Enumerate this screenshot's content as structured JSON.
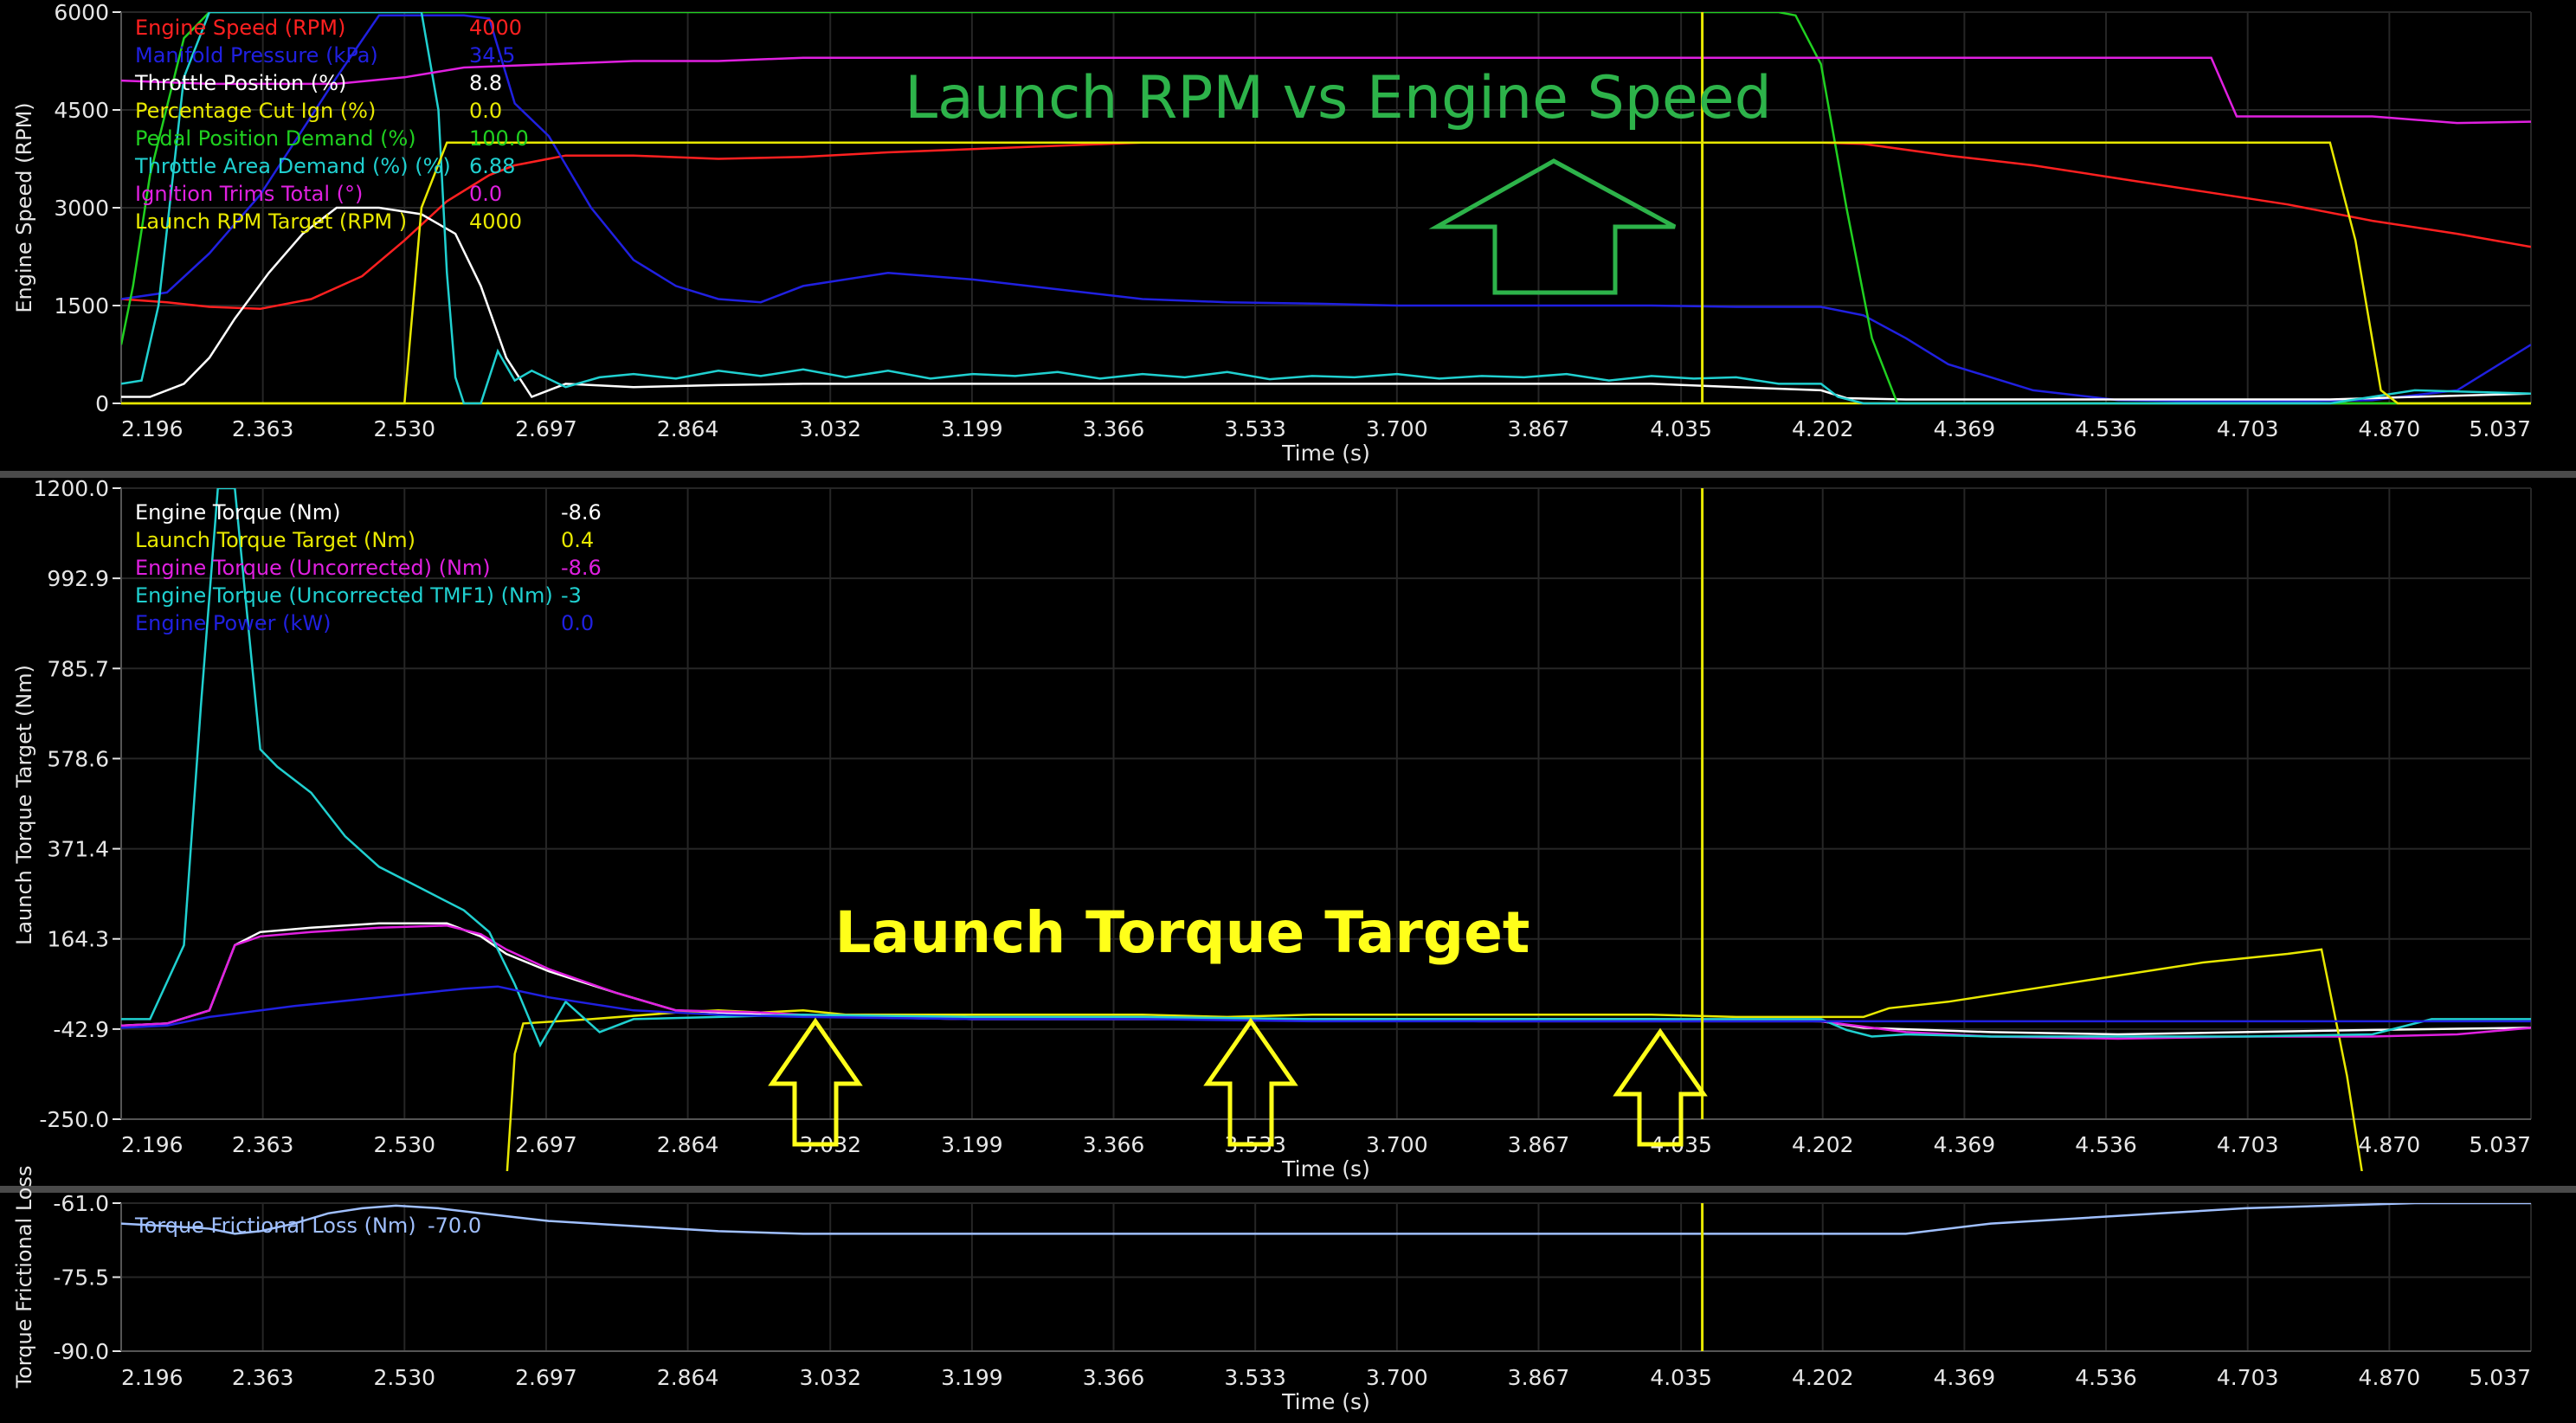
{
  "colors": {
    "background": "#000000",
    "grid": "#262626",
    "axis_text": "#e6e6e6",
    "divider": "#4a4a4a",
    "cursor": "#e8e800",
    "annotation_green": "#2db34a",
    "annotation_yellow": "#ffff1a"
  },
  "time_ticks": [
    "2.196",
    "2.363",
    "2.530",
    "2.697",
    "2.864",
    "3.032",
    "3.199",
    "3.366",
    "3.533",
    "3.700",
    "3.867",
    "4.035",
    "4.202",
    "4.369",
    "4.536",
    "4.703",
    "4.870",
    "5.037"
  ],
  "xlabel": "Time (s)",
  "cursor_time": 4.06,
  "chart_data": [
    {
      "type": "line",
      "ylabel": "Engine Speed (RPM)",
      "ylim": [
        0,
        6000
      ],
      "xlim": [
        2.196,
        5.037
      ],
      "y_ticks": [
        "6000",
        "4500",
        "3000",
        "1500",
        "0"
      ],
      "grid": true,
      "legend_placement": "top-left",
      "annotation": "Launch RPM vs Engine Speed",
      "series": [
        {
          "name": "Engine Speed (RPM)",
          "cursor_value": "4000",
          "color": "#ff2020",
          "x": [
            2.196,
            2.25,
            2.3,
            2.36,
            2.42,
            2.48,
            2.53,
            2.58,
            2.63,
            2.66,
            2.72,
            2.8,
            2.9,
            3.0,
            3.1,
            3.2,
            3.3,
            3.4,
            3.5,
            3.6,
            3.7,
            3.8,
            3.9,
            4.0,
            4.1,
            4.2,
            4.25,
            4.35,
            4.45,
            4.55,
            4.65,
            4.75,
            4.85,
            4.95,
            5.037
          ],
          "y": [
            1600,
            1550,
            1480,
            1450,
            1600,
            1950,
            2500,
            3100,
            3500,
            3650,
            3800,
            3800,
            3750,
            3780,
            3850,
            3900,
            3950,
            4000,
            4000,
            4000,
            4000,
            4000,
            4000,
            4000,
            4000,
            4000,
            3980,
            3800,
            3650,
            3450,
            3250,
            3050,
            2800,
            2600,
            2400
          ]
        },
        {
          "name": "Manifold Pressure (kPa)",
          "cursor_value": "34.5",
          "color": "#2020e0",
          "x": [
            2.196,
            2.25,
            2.3,
            2.36,
            2.4,
            2.45,
            2.5,
            2.53,
            2.56,
            2.6,
            2.63,
            2.66,
            2.7,
            2.75,
            2.8,
            2.85,
            2.9,
            2.95,
            3.0,
            3.1,
            3.2,
            3.3,
            3.4,
            3.5,
            3.6,
            3.7,
            3.8,
            3.9,
            4.0,
            4.1,
            4.2,
            4.25,
            4.3,
            4.35,
            4.45,
            4.55,
            4.65,
            4.75,
            4.85,
            4.95,
            5.037
          ],
          "y": [
            1600,
            1700,
            2300,
            3200,
            4000,
            5000,
            5950,
            5950,
            5950,
            5950,
            5900,
            4600,
            4100,
            3000,
            2200,
            1800,
            1600,
            1550,
            1800,
            2000,
            1900,
            1750,
            1600,
            1550,
            1530,
            1500,
            1500,
            1500,
            1500,
            1480,
            1480,
            1350,
            1000,
            600,
            200,
            50,
            30,
            30,
            50,
            200,
            900
          ]
        },
        {
          "name": "Throttle Position (%)",
          "cursor_value": "8.8",
          "color": "#ffffff",
          "x": [
            2.196,
            2.23,
            2.27,
            2.3,
            2.33,
            2.37,
            2.41,
            2.45,
            2.5,
            2.55,
            2.59,
            2.62,
            2.65,
            2.68,
            2.72,
            2.8,
            2.9,
            3.0,
            3.1,
            3.2,
            3.3,
            3.4,
            3.5,
            3.6,
            3.7,
            3.8,
            3.9,
            4.0,
            4.1,
            4.2,
            4.23,
            4.3,
            4.4,
            4.5,
            4.6,
            4.7,
            4.8,
            4.9,
            5.037
          ],
          "y": [
            100,
            100,
            300,
            700,
            1300,
            2000,
            2600,
            3000,
            3000,
            2900,
            2600,
            1800,
            700,
            100,
            300,
            250,
            280,
            300,
            300,
            300,
            300,
            300,
            300,
            300,
            300,
            300,
            300,
            300,
            250,
            200,
            80,
            60,
            60,
            60,
            60,
            60,
            60,
            100,
            150
          ]
        },
        {
          "name": "Percentage Cut Ign (%)",
          "cursor_value": "0.0",
          "color": "#e8e800",
          "x": [
            2.196,
            5.037
          ],
          "y": [
            0,
            0
          ]
        },
        {
          "name": "Pedal Position Demand (%)",
          "cursor_value": "100.0",
          "color": "#20d020",
          "x": [
            2.196,
            2.21,
            2.23,
            2.27,
            2.3,
            4.15,
            4.17,
            4.2,
            4.23,
            4.26,
            4.29,
            5.037
          ],
          "y": [
            900,
            1800,
            3500,
            5600,
            6000,
            6000,
            5950,
            5200,
            3000,
            1000,
            0,
            0
          ]
        },
        {
          "name": "Throttle Area Demand  (%) (%)",
          "cursor_value": "6.88",
          "color": "#20d0d0",
          "x": [
            2.196,
            2.22,
            2.24,
            2.27,
            2.3,
            2.55,
            2.57,
            2.58,
            2.59,
            2.6,
            2.62,
            2.64,
            2.66,
            2.68,
            2.72,
            2.76,
            2.8,
            2.85,
            2.9,
            2.95,
            3.0,
            3.05,
            3.1,
            3.15,
            3.2,
            3.25,
            3.3,
            3.35,
            3.4,
            3.45,
            3.5,
            3.55,
            3.6,
            3.65,
            3.7,
            3.75,
            3.8,
            3.85,
            3.9,
            3.95,
            4.0,
            4.05,
            4.1,
            4.15,
            4.2,
            4.22,
            4.25,
            4.3,
            4.4,
            4.5,
            4.6,
            4.7,
            4.8,
            4.9,
            5.037
          ],
          "y": [
            300,
            350,
            1500,
            5000,
            6000,
            6000,
            4500,
            2000,
            400,
            0,
            0,
            800,
            350,
            500,
            250,
            400,
            450,
            380,
            500,
            420,
            520,
            400,
            500,
            380,
            450,
            420,
            480,
            380,
            450,
            400,
            480,
            370,
            420,
            400,
            450,
            380,
            420,
            400,
            450,
            350,
            420,
            380,
            400,
            300,
            300,
            100,
            0,
            0,
            0,
            0,
            0,
            0,
            0,
            200,
            150
          ]
        },
        {
          "name": "Ignition Trims Total (°)",
          "cursor_value": "0.0",
          "color": "#e020e0",
          "x": [
            2.196,
            2.3,
            2.45,
            2.53,
            2.6,
            2.7,
            2.8,
            2.9,
            3.0,
            3.1,
            3.2,
            3.3,
            3.5,
            3.7,
            3.9,
            4.0,
            4.1,
            4.2,
            4.4,
            4.55,
            4.66,
            4.69,
            4.75,
            4.85,
            4.95,
            5.037
          ],
          "y": [
            4950,
            4900,
            4900,
            5000,
            5150,
            5200,
            5250,
            5250,
            5300,
            5300,
            5300,
            5300,
            5300,
            5300,
            5300,
            5300,
            5300,
            5300,
            5300,
            5300,
            5300,
            4400,
            4400,
            4400,
            4300,
            4320
          ]
        },
        {
          "name": "Launch RPM Target (RPM )",
          "cursor_value": "4000",
          "color": "#e8e800",
          "x": [
            2.196,
            2.53,
            2.55,
            2.58,
            2.6,
            4.8,
            4.83,
            4.86,
            4.88,
            5.037
          ],
          "y": [
            0,
            0,
            3000,
            4000,
            4000,
            4000,
            2500,
            200,
            0,
            0
          ]
        }
      ]
    },
    {
      "type": "line",
      "ylabel": "Launch Torque Target (Nm)",
      "ylim": [
        -250,
        1200
      ],
      "xlim": [
        2.196,
        5.037
      ],
      "y_ticks": [
        "1200.0",
        "992.9",
        "785.7",
        "578.6",
        "371.4",
        "164.3",
        "-42.9",
        "-250.0"
      ],
      "grid": true,
      "legend_placement": "top-left",
      "annotation": "Launch Torque Target",
      "series": [
        {
          "name": "Engine Torque (Nm)",
          "cursor_value": "-8.6",
          "color": "#ffffff",
          "x": [
            2.196,
            2.25,
            2.3,
            2.33,
            2.36,
            2.42,
            2.5,
            2.58,
            2.62,
            2.65,
            2.7,
            2.78,
            2.85,
            2.95,
            3.05,
            3.2,
            3.4,
            3.6,
            3.8,
            4.0,
            4.2,
            4.25,
            4.4,
            4.55,
            4.7,
            4.85,
            5.037
          ],
          "y": [
            -35,
            -30,
            0,
            150,
            180,
            190,
            200,
            200,
            170,
            130,
            90,
            40,
            0,
            -10,
            -15,
            -20,
            -20,
            -20,
            -20,
            -20,
            -25,
            -40,
            -50,
            -55,
            -50,
            -45,
            -40
          ]
        },
        {
          "name": "Launch Torque Target (Nm)",
          "cursor_value": "0.4",
          "color": "#e8e800",
          "x": [
            2.196,
            2.63,
            2.65,
            2.66,
            2.67,
            2.75,
            2.85,
            2.9,
            2.95,
            3.0,
            3.05,
            3.1,
            3.2,
            3.3,
            3.4,
            3.5,
            3.6,
            3.7,
            3.8,
            3.9,
            4.0,
            4.1,
            4.2,
            4.25,
            4.28,
            4.35,
            4.45,
            4.55,
            4.65,
            4.75,
            4.79,
            4.82,
            4.84,
            5.037
          ],
          "y": [
            -1000,
            -1000,
            -400,
            -100,
            -30,
            -20,
            -5,
            0,
            -5,
            0,
            -10,
            -10,
            -10,
            -10,
            -10,
            -15,
            -10,
            -10,
            -10,
            -10,
            -10,
            -15,
            -15,
            -15,
            5,
            20,
            50,
            80,
            110,
            130,
            140,
            -150,
            -400,
            -400
          ]
        },
        {
          "name": "Engine Torque (Uncorrected) (Nm)",
          "cursor_value": "-8.6",
          "color": "#e020e0",
          "x": [
            2.196,
            2.25,
            2.3,
            2.33,
            2.36,
            2.42,
            2.5,
            2.58,
            2.62,
            2.65,
            2.7,
            2.78,
            2.85,
            2.95,
            3.05,
            3.2,
            3.4,
            3.6,
            3.8,
            4.0,
            4.2,
            4.3,
            4.4,
            4.55,
            4.7,
            4.85,
            4.95,
            5.037
          ],
          "y": [
            -35,
            -30,
            0,
            150,
            170,
            180,
            190,
            195,
            175,
            140,
            95,
            40,
            0,
            -5,
            -15,
            -20,
            -20,
            -20,
            -25,
            -25,
            -25,
            -50,
            -60,
            -65,
            -60,
            -60,
            -55,
            -40
          ]
        },
        {
          "name": "Engine Torque (Uncorrected TMF1) (Nm)",
          "cursor_value": "-3",
          "color": "#20d0d0",
          "x": [
            2.196,
            2.23,
            2.27,
            2.29,
            2.31,
            2.33,
            2.35,
            2.36,
            2.38,
            2.42,
            2.46,
            2.5,
            2.55,
            2.6,
            2.63,
            2.66,
            2.69,
            2.72,
            2.76,
            2.8,
            2.9,
            3.0,
            3.2,
            3.4,
            3.6,
            3.8,
            4.0,
            4.2,
            4.23,
            4.26,
            4.3,
            4.4,
            4.55,
            4.7,
            4.85,
            4.92,
            5.037
          ],
          "y": [
            -20,
            -20,
            150,
            700,
            1200,
            1200,
            800,
            600,
            560,
            500,
            400,
            330,
            280,
            230,
            180,
            60,
            -80,
            20,
            -50,
            -20,
            -15,
            -10,
            -15,
            -15,
            -20,
            -20,
            -20,
            -20,
            -45,
            -60,
            -55,
            -60,
            -60,
            -60,
            -55,
            -20,
            -20
          ]
        },
        {
          "name": "Engine Power (kW)",
          "cursor_value": "0.0",
          "color": "#2020e0",
          "x": [
            2.196,
            2.25,
            2.3,
            2.4,
            2.5,
            2.6,
            2.64,
            2.7,
            2.8,
            2.9,
            3.0,
            3.2,
            3.4,
            3.6,
            3.8,
            4.0,
            4.2,
            4.4,
            4.6,
            4.8,
            5.037
          ],
          "y": [
            -40,
            -35,
            -15,
            10,
            30,
            50,
            55,
            30,
            0,
            -10,
            -15,
            -20,
            -20,
            -25,
            -25,
            -25,
            -25,
            -25,
            -25,
            -25,
            -25
          ]
        }
      ]
    },
    {
      "type": "line",
      "ylabel": "Torque Frictional Loss",
      "ylim": [
        -90,
        -61
      ],
      "xlim": [
        2.196,
        5.037
      ],
      "y_ticks": [
        "-61.0",
        "-75.5",
        "-90.0"
      ],
      "grid": true,
      "legend_placement": "top-left",
      "series": [
        {
          "name": "Torque Frictional Loss (Nm)",
          "cursor_value": "-70.0",
          "color": "#a0c0ff",
          "x": [
            2.196,
            2.25,
            2.3,
            2.33,
            2.36,
            2.4,
            2.44,
            2.48,
            2.52,
            2.57,
            2.62,
            2.7,
            2.8,
            2.9,
            3.0,
            3.2,
            3.4,
            3.6,
            3.8,
            4.0,
            4.2,
            4.3,
            4.4,
            4.5,
            4.6,
            4.7,
            4.8,
            4.9,
            5.037
          ],
          "y": [
            -65,
            -65.5,
            -66,
            -67,
            -66.5,
            -65,
            -63,
            -62,
            -61.5,
            -62,
            -63,
            -64.5,
            -65.5,
            -66.5,
            -67,
            -67,
            -67,
            -67,
            -67,
            -67,
            -67,
            -67,
            -65,
            -64,
            -63,
            -62,
            -61.5,
            -61,
            -61
          ]
        }
      ]
    }
  ]
}
